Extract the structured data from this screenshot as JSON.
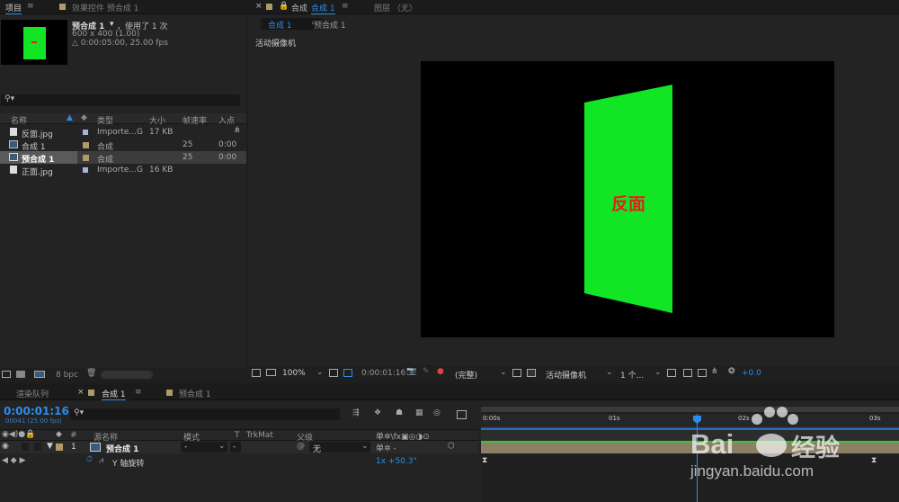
{
  "project_panel": {
    "tab_label": "项目",
    "menu_icon": "hamburger-icon",
    "effects_tab": "效果控件 预合成 1",
    "selected_name": "预合成 1",
    "used_text": "，使用了 1 次",
    "dimensions": "600 x 400 (1.00)",
    "duration": "△ 0:00:05:00, 25.00 fps",
    "search_placeholder": "",
    "columns": [
      "名称",
      "类型",
      "大小",
      "帧速率",
      "入点"
    ],
    "rows": [
      {
        "name": "反面.jpg",
        "type": "Importe...G",
        "size": "17 KB",
        "fps": "",
        "inpoint": ""
      },
      {
        "name": "合成 1",
        "type": "合成",
        "size": "",
        "fps": "25",
        "inpoint": "0:00"
      },
      {
        "name": "预合成 1",
        "type": "合成",
        "size": "",
        "fps": "25",
        "inpoint": "0:00"
      },
      {
        "name": "正面.jpg",
        "type": "Importe...G",
        "size": "16 KB",
        "fps": "",
        "inpoint": ""
      }
    ],
    "bpc": "8 bpc"
  },
  "viewer": {
    "tab_close": "×",
    "tab_label": "合成",
    "tab_comp": "合成 1",
    "layer_tab": "图层 （无）",
    "breadcrumb_1": "合成 1",
    "breadcrumb_2": "预合成 1",
    "camera_label": "活动摄像机",
    "card_text": "反面",
    "zoom": "100%",
    "timecode": "0:00:01:16",
    "resolution": "(完整)",
    "camera_select": "活动摄像机",
    "views": "1 个...",
    "exposure": "+0.0",
    "colors": {
      "card": "#12e624",
      "card_text": "#e0231b",
      "accent": "#2d8ceb"
    }
  },
  "timeline": {
    "render_queue": "渲染队列",
    "tab_close": "×",
    "tab_comp": "合成 1",
    "tab_precomp": "预合成 1",
    "timecode": "0:00:01:16",
    "frame_info": "00041 (25.00 fps)",
    "columns": {
      "num": "#",
      "source": "源名称",
      "mode": "模式",
      "t": "T",
      "trkmat": "TrkMat",
      "parent": "父级"
    },
    "layer": {
      "index": "1",
      "name": "预合成 1",
      "mode": "-",
      "trkmat": "-",
      "parent": "无"
    },
    "property": {
      "name": "Y 轴旋转",
      "value": "1x +50.3°"
    },
    "ruler": [
      "0:00s",
      "01s",
      "02s",
      "03s"
    ]
  },
  "watermark": {
    "brand": "Bai",
    "brand_cn": "经验",
    "url": "jingyan.baidu.com"
  }
}
